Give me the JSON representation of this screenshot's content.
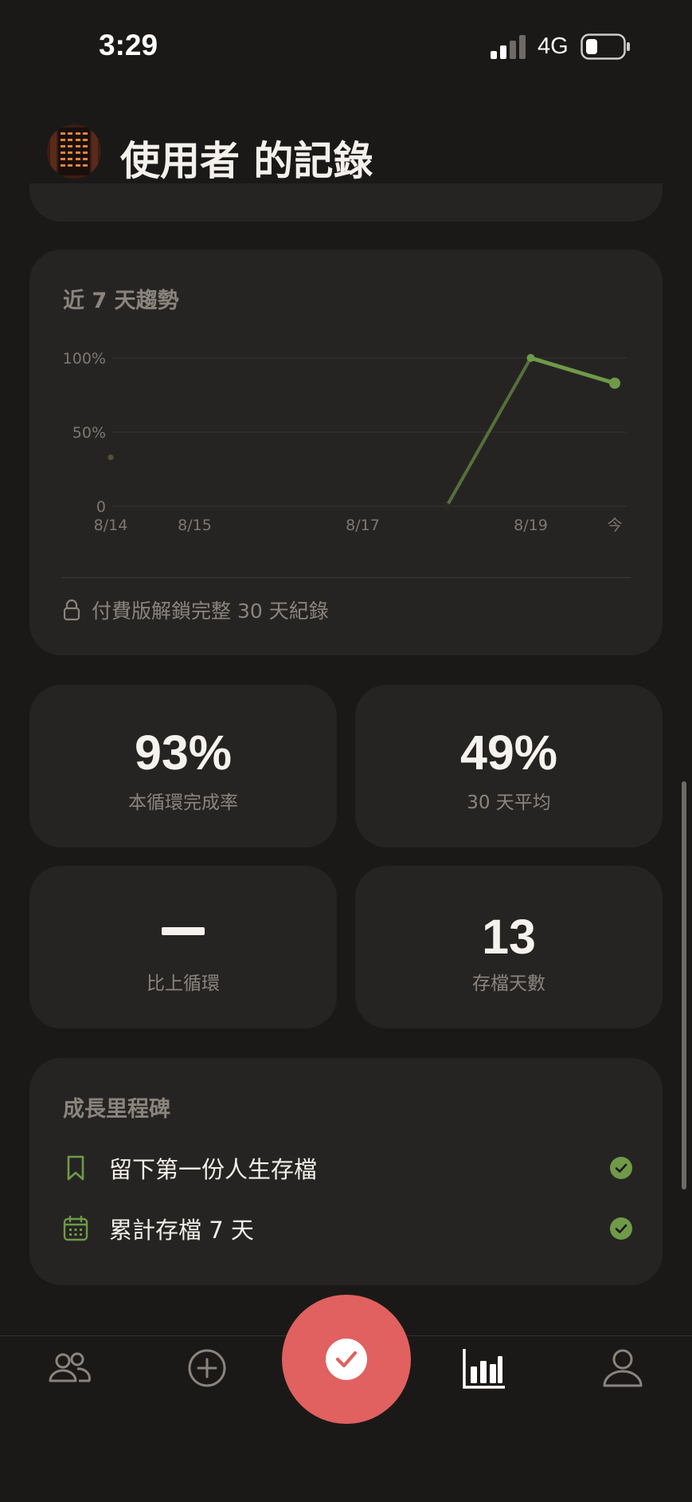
{
  "status_bar": {
    "time": "3:29",
    "network": "4G"
  },
  "header": {
    "title": "使用者 的記錄"
  },
  "trend": {
    "title": "近 7 天趨勢",
    "lock_text": "付費版解鎖完整 30 天紀錄"
  },
  "chart_data": {
    "type": "line",
    "title": "近 7 天趨勢",
    "x_tick_labels": [
      "8/14",
      "8/15",
      "8/17",
      "8/19",
      "今"
    ],
    "y_tick_labels": [
      "100%",
      "50%",
      "0"
    ],
    "ylim": [
      0,
      100
    ],
    "grid": true,
    "series": [
      {
        "x": [
          "8/14",
          "8/18",
          "8/19",
          "今"
        ],
        "values": [
          33,
          0,
          100,
          83
        ]
      }
    ]
  },
  "stats": [
    {
      "value": "93%",
      "label": "本循環完成率"
    },
    {
      "value": "49%",
      "label": "30 天平均"
    },
    {
      "value": "—",
      "label": "比上循環"
    },
    {
      "value": "13",
      "label": "存檔天數"
    }
  ],
  "milestones": {
    "title": "成長里程碑",
    "items": [
      {
        "label": "留下第一份人生存檔",
        "icon": "bookmark-icon",
        "done": true
      },
      {
        "label": "累計存檔 7 天",
        "icon": "calendar-icon",
        "done": true
      }
    ]
  },
  "tab_bar": {
    "items": [
      "friends-icon",
      "add-icon",
      "checkin-button",
      "stats-icon",
      "profile-icon"
    ]
  },
  "colors": {
    "background": "#1b1918",
    "card": "#262423",
    "accent_green": "#6f9a48",
    "accent_red": "#e0615f",
    "muted_text": "#8a847d"
  }
}
